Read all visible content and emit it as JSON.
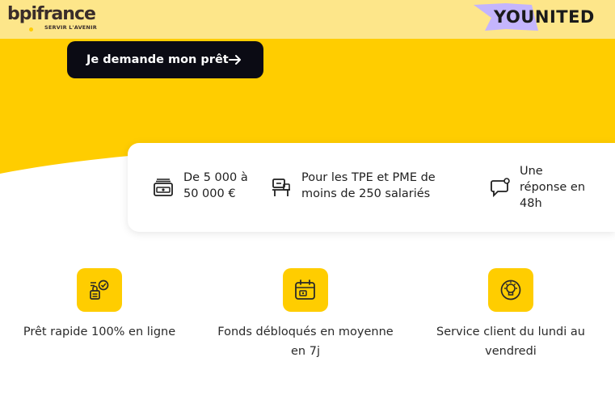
{
  "header": {
    "brand_bpi": "bpifrance",
    "brand_bpi_tagline": "SERVIR L'AVENIR",
    "brand_partner": "YOUNITED"
  },
  "hero": {
    "cta_label": "Je demande mon prêt"
  },
  "info_card": {
    "items": [
      {
        "icon": "banknote-icon",
        "text_line1": "De 5 000 à",
        "text_line2": "50 000 €"
      },
      {
        "icon": "workspace-icon",
        "text_line1": "Pour les TPE et PME de",
        "text_line2": "moins de 250 salariés"
      },
      {
        "icon": "chat-bubble-icon",
        "text_line1": "Une",
        "text_line2": "réponse en",
        "text_line3": "48h"
      }
    ]
  },
  "features": [
    {
      "icon": "fast-loan-icon",
      "line1": "Prêt rapide 100% en ligne",
      "line2": ""
    },
    {
      "icon": "calendar-icon",
      "line1": "Fonds débloqués en moyenne",
      "line2": "en 7j"
    },
    {
      "icon": "lightbulb-icon",
      "line1": "Service client du lundi au",
      "line2": "vendredi"
    }
  ],
  "colors": {
    "brand_yellow": "#ffcd00",
    "topbar_yellow": "#fde68a",
    "cta_dark": "#0b0b14",
    "partner_purple": "#c4b5fd"
  }
}
